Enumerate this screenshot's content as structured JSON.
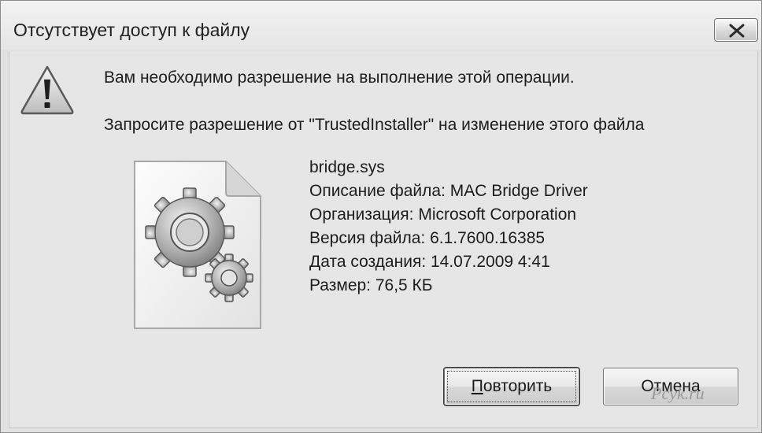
{
  "window": {
    "title": "Отсутствует доступ к файлу",
    "close_icon": "close-icon"
  },
  "message": {
    "icon": "warning-icon",
    "line1": "Вам необходимо разрешение на выполнение этой операции.",
    "line2": "Запросите разрешение от \"TrustedInstaller\" на изменение этого файла"
  },
  "file": {
    "icon": "system-file-gears-icon",
    "name": "bridge.sys",
    "description": "Описание файла: MAC Bridge Driver",
    "organization": "Организация: Microsoft Corporation",
    "version": "Версия файла: 6.1.7600.16385",
    "created": "Дата создания: 14.07.2009 4:41",
    "size": "Размер: 76,5 КБ"
  },
  "buttons": {
    "retry_accel": "П",
    "retry_rest": "овторить",
    "cancel": "Отмена"
  },
  "watermark": "Pcyk.ru"
}
